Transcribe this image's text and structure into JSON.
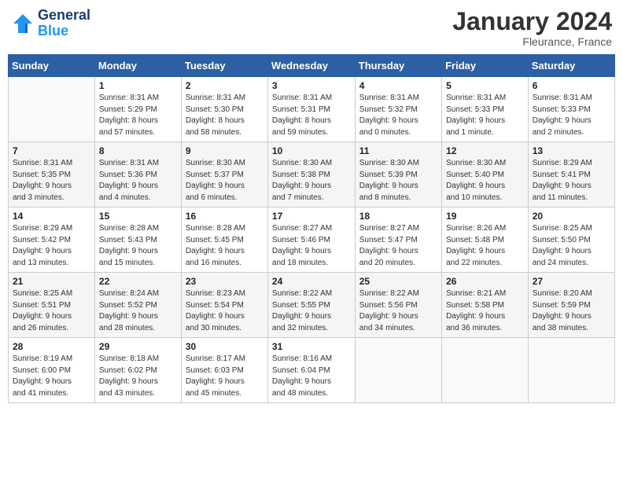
{
  "header": {
    "logo_line1": "General",
    "logo_line2": "Blue",
    "month_year": "January 2024",
    "location": "Fleurance, France"
  },
  "weekdays": [
    "Sunday",
    "Monday",
    "Tuesday",
    "Wednesday",
    "Thursday",
    "Friday",
    "Saturday"
  ],
  "weeks": [
    [
      {
        "day": "",
        "info": ""
      },
      {
        "day": "1",
        "info": "Sunrise: 8:31 AM\nSunset: 5:29 PM\nDaylight: 8 hours\nand 57 minutes."
      },
      {
        "day": "2",
        "info": "Sunrise: 8:31 AM\nSunset: 5:30 PM\nDaylight: 8 hours\nand 58 minutes."
      },
      {
        "day": "3",
        "info": "Sunrise: 8:31 AM\nSunset: 5:31 PM\nDaylight: 8 hours\nand 59 minutes."
      },
      {
        "day": "4",
        "info": "Sunrise: 8:31 AM\nSunset: 5:32 PM\nDaylight: 9 hours\nand 0 minutes."
      },
      {
        "day": "5",
        "info": "Sunrise: 8:31 AM\nSunset: 5:33 PM\nDaylight: 9 hours\nand 1 minute."
      },
      {
        "day": "6",
        "info": "Sunrise: 8:31 AM\nSunset: 5:33 PM\nDaylight: 9 hours\nand 2 minutes."
      }
    ],
    [
      {
        "day": "7",
        "info": "Sunrise: 8:31 AM\nSunset: 5:35 PM\nDaylight: 9 hours\nand 3 minutes."
      },
      {
        "day": "8",
        "info": "Sunrise: 8:31 AM\nSunset: 5:36 PM\nDaylight: 9 hours\nand 4 minutes."
      },
      {
        "day": "9",
        "info": "Sunrise: 8:30 AM\nSunset: 5:37 PM\nDaylight: 9 hours\nand 6 minutes."
      },
      {
        "day": "10",
        "info": "Sunrise: 8:30 AM\nSunset: 5:38 PM\nDaylight: 9 hours\nand 7 minutes."
      },
      {
        "day": "11",
        "info": "Sunrise: 8:30 AM\nSunset: 5:39 PM\nDaylight: 9 hours\nand 8 minutes."
      },
      {
        "day": "12",
        "info": "Sunrise: 8:30 AM\nSunset: 5:40 PM\nDaylight: 9 hours\nand 10 minutes."
      },
      {
        "day": "13",
        "info": "Sunrise: 8:29 AM\nSunset: 5:41 PM\nDaylight: 9 hours\nand 11 minutes."
      }
    ],
    [
      {
        "day": "14",
        "info": "Sunrise: 8:29 AM\nSunset: 5:42 PM\nDaylight: 9 hours\nand 13 minutes."
      },
      {
        "day": "15",
        "info": "Sunrise: 8:28 AM\nSunset: 5:43 PM\nDaylight: 9 hours\nand 15 minutes."
      },
      {
        "day": "16",
        "info": "Sunrise: 8:28 AM\nSunset: 5:45 PM\nDaylight: 9 hours\nand 16 minutes."
      },
      {
        "day": "17",
        "info": "Sunrise: 8:27 AM\nSunset: 5:46 PM\nDaylight: 9 hours\nand 18 minutes."
      },
      {
        "day": "18",
        "info": "Sunrise: 8:27 AM\nSunset: 5:47 PM\nDaylight: 9 hours\nand 20 minutes."
      },
      {
        "day": "19",
        "info": "Sunrise: 8:26 AM\nSunset: 5:48 PM\nDaylight: 9 hours\nand 22 minutes."
      },
      {
        "day": "20",
        "info": "Sunrise: 8:25 AM\nSunset: 5:50 PM\nDaylight: 9 hours\nand 24 minutes."
      }
    ],
    [
      {
        "day": "21",
        "info": "Sunrise: 8:25 AM\nSunset: 5:51 PM\nDaylight: 9 hours\nand 26 minutes."
      },
      {
        "day": "22",
        "info": "Sunrise: 8:24 AM\nSunset: 5:52 PM\nDaylight: 9 hours\nand 28 minutes."
      },
      {
        "day": "23",
        "info": "Sunrise: 8:23 AM\nSunset: 5:54 PM\nDaylight: 9 hours\nand 30 minutes."
      },
      {
        "day": "24",
        "info": "Sunrise: 8:22 AM\nSunset: 5:55 PM\nDaylight: 9 hours\nand 32 minutes."
      },
      {
        "day": "25",
        "info": "Sunrise: 8:22 AM\nSunset: 5:56 PM\nDaylight: 9 hours\nand 34 minutes."
      },
      {
        "day": "26",
        "info": "Sunrise: 8:21 AM\nSunset: 5:58 PM\nDaylight: 9 hours\nand 36 minutes."
      },
      {
        "day": "27",
        "info": "Sunrise: 8:20 AM\nSunset: 5:59 PM\nDaylight: 9 hours\nand 38 minutes."
      }
    ],
    [
      {
        "day": "28",
        "info": "Sunrise: 8:19 AM\nSunset: 6:00 PM\nDaylight: 9 hours\nand 41 minutes."
      },
      {
        "day": "29",
        "info": "Sunrise: 8:18 AM\nSunset: 6:02 PM\nDaylight: 9 hours\nand 43 minutes."
      },
      {
        "day": "30",
        "info": "Sunrise: 8:17 AM\nSunset: 6:03 PM\nDaylight: 9 hours\nand 45 minutes."
      },
      {
        "day": "31",
        "info": "Sunrise: 8:16 AM\nSunset: 6:04 PM\nDaylight: 9 hours\nand 48 minutes."
      },
      {
        "day": "",
        "info": ""
      },
      {
        "day": "",
        "info": ""
      },
      {
        "day": "",
        "info": ""
      }
    ]
  ]
}
